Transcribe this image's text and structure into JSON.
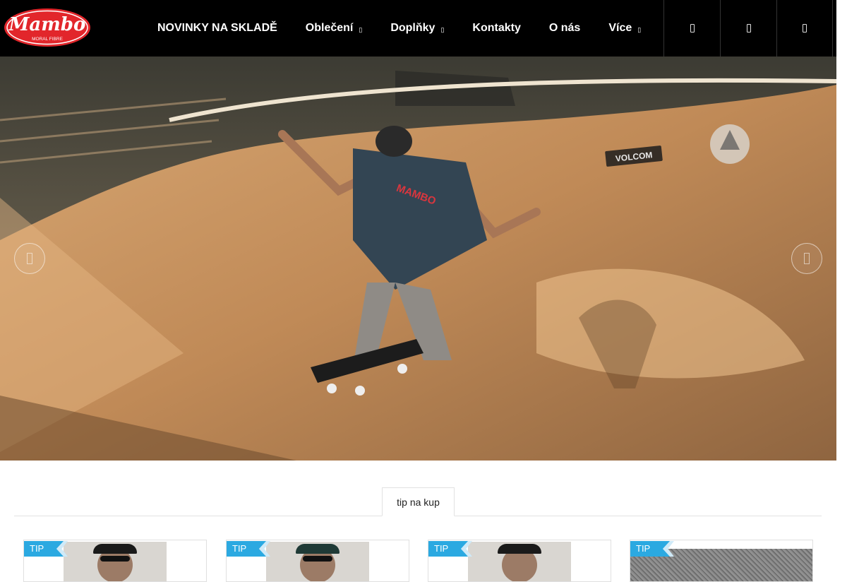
{
  "brand": {
    "logo_text": "Mambo",
    "logo_subtext": "MORAL FIBRE",
    "logo_color": "#e2262b"
  },
  "nav": {
    "items": [
      {
        "label": "NOVINKY NA SKLADĚ",
        "has_dropdown": false
      },
      {
        "label": "Oblečení",
        "has_dropdown": true
      },
      {
        "label": "Doplňky",
        "has_dropdown": true
      },
      {
        "label": "Kontakty",
        "has_dropdown": false
      },
      {
        "label": "O nás",
        "has_dropdown": false
      },
      {
        "label": "Více",
        "has_dropdown": true
      }
    ],
    "icons": [
      "user-icon",
      "search-icon",
      "cart-icon"
    ]
  },
  "hero": {
    "ramp_logo_text": "VOLCOM",
    "shirt_text": "MAMBO",
    "prev_icon": "chevron-left-icon",
    "next_icon": "chevron-right-icon"
  },
  "tabs": {
    "active": "tip na kup"
  },
  "products": [
    {
      "badge": "TIP",
      "image": "man-cap-sunglasses"
    },
    {
      "badge": "TIP",
      "image": "man-cap-sunglasses"
    },
    {
      "badge": "TIP",
      "image": "man-cap"
    },
    {
      "badge": "TIP",
      "image": "granite-texture"
    }
  ],
  "colors": {
    "header_bg": "#000000",
    "badge": "#2ba9e1",
    "badge_light": "#cfeaf8"
  }
}
